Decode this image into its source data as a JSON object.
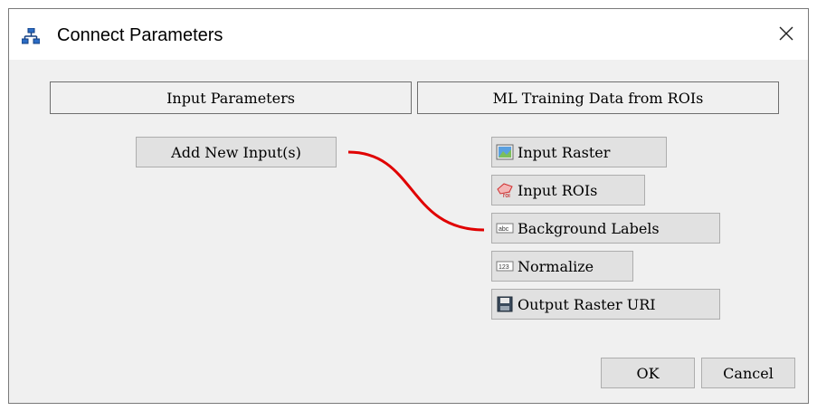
{
  "window": {
    "title": "Connect Parameters"
  },
  "headers": {
    "input": "Input Parameters",
    "task": "ML Training Data from ROIs"
  },
  "add_input_label": "Add New Input(s)",
  "parameters": [
    {
      "label": "Input Raster",
      "icon": "raster-image-icon"
    },
    {
      "label": "Input ROIs",
      "icon": "roi-icon"
    },
    {
      "label": "Background Labels",
      "icon": "abc-text-icon"
    },
    {
      "label": "Normalize",
      "icon": "number-123-icon"
    },
    {
      "label": "Output Raster URI",
      "icon": "floppy-disk-icon"
    }
  ],
  "connection": {
    "from": "Add New Input(s)",
    "to": "Background Labels",
    "color": "#e00000"
  },
  "buttons": {
    "ok": "OK",
    "cancel": "Cancel"
  },
  "colors": {
    "dialog_bg": "#f0f0f0",
    "button_bg": "#e1e1e1",
    "wire": "#e00000"
  }
}
